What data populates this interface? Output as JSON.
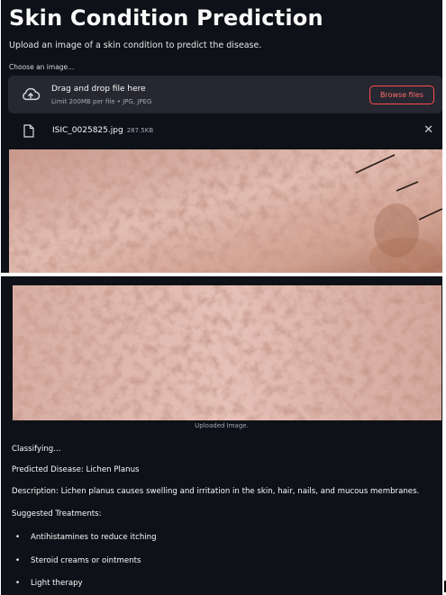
{
  "page": {
    "title": "Skin Condition Prediction",
    "subtitle": "Upload an image of a skin condition to predict the disease."
  },
  "uploader": {
    "label": "Choose an image...",
    "drop_text": "Drag and drop file here",
    "limit_text": "Limit 200MB per file • JPG, JPEG",
    "browse_label": "Browse files",
    "icons": {
      "upload": "cloud-upload-icon",
      "file": "file-icon",
      "close": "close-icon"
    }
  },
  "file": {
    "name": "ISIC_0025825.jpg",
    "size": "287.5KB",
    "remove_glyph": "✕"
  },
  "result": {
    "caption": "Uploaded Image.",
    "status": "Classifying...",
    "predicted": "Predicted Disease: Lichen Planus",
    "description": "Description: Lichen planus causes swelling and irritation in the skin, hair, nails, and mucous membranes.",
    "treatments_heading": "Suggested Treatments:",
    "bullet_glyph": "•",
    "treatments": [
      "Antihistamines to reduce itching",
      "Steroid creams or ointments",
      "Light therapy"
    ]
  },
  "colors": {
    "background": "#0e1117",
    "panel": "#262730",
    "accent": "#ff4b4b",
    "text": "#fafafa",
    "muted": "#a3a8b8"
  }
}
